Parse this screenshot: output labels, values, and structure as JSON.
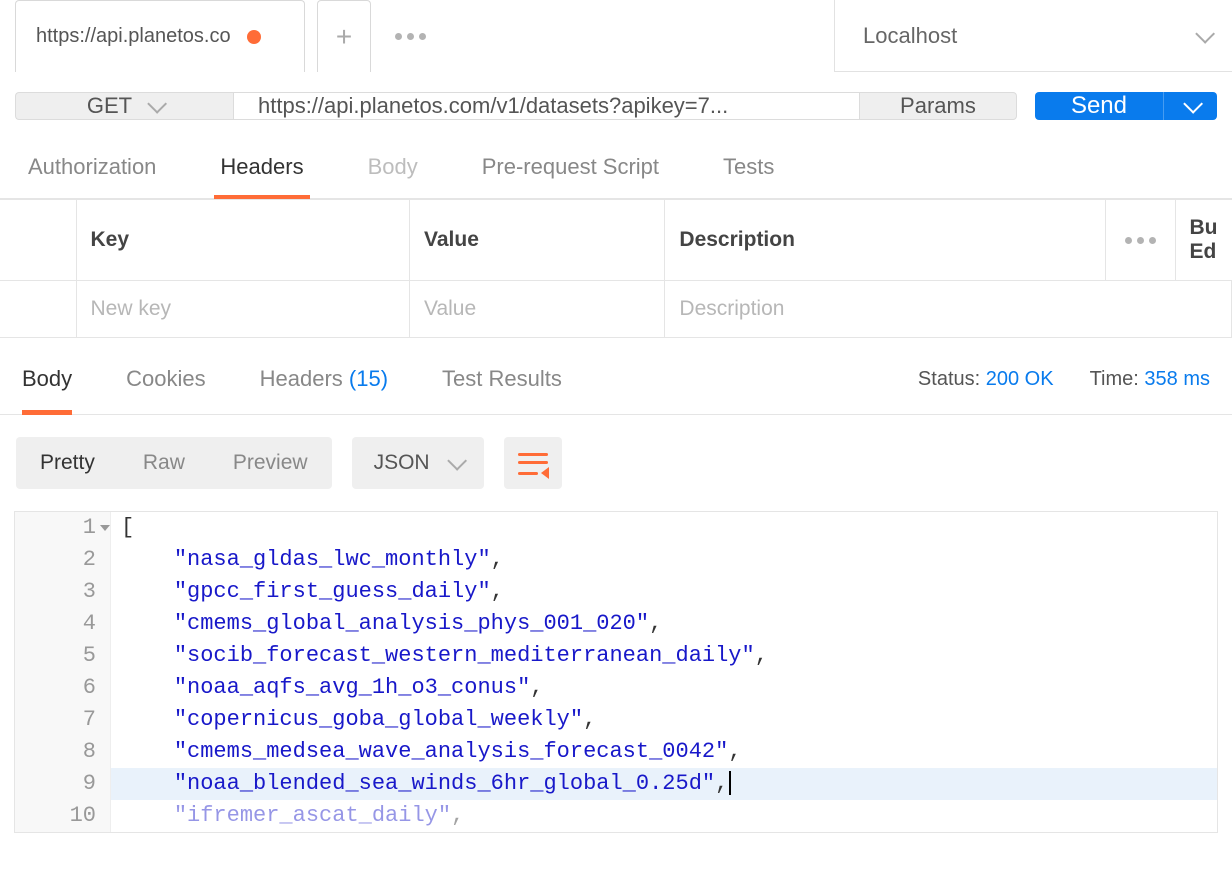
{
  "tabs": {
    "active_title": "https://api.planetos.co"
  },
  "environment": {
    "selected": "Localhost"
  },
  "request": {
    "method": "GET",
    "url_display": "https://api.planetos.com/v1/datasets?apikey=7...",
    "params_label": "Params",
    "send_label": "Send"
  },
  "request_tabs": {
    "authorization": "Authorization",
    "headers": "Headers",
    "body": "Body",
    "prerequest": "Pre-request Script",
    "tests": "Tests"
  },
  "headers_table": {
    "col_key": "Key",
    "col_value": "Value",
    "col_desc": "Description",
    "bulk_link_1": "Bu",
    "bulk_link_2": "Ed",
    "placeholder_key": "New key",
    "placeholder_value": "Value",
    "placeholder_desc": "Description"
  },
  "response_tabs": {
    "body": "Body",
    "cookies": "Cookies",
    "headers": "Headers",
    "headers_count": "(15)",
    "tests": "Test Results"
  },
  "response_meta": {
    "status_label": "Status:",
    "status_value": "200 OK",
    "time_label": "Time:",
    "time_value": "358 ms"
  },
  "body_view": {
    "pretty": "Pretty",
    "raw": "Raw",
    "preview": "Preview",
    "format": "JSON"
  },
  "response_body": {
    "lines": [
      {
        "n": "1",
        "indent": "",
        "text": "[",
        "string": false,
        "comma": false,
        "fold": true
      },
      {
        "n": "2",
        "indent": "    ",
        "text": "nasa_gldas_lwc_monthly",
        "string": true,
        "comma": true
      },
      {
        "n": "3",
        "indent": "    ",
        "text": "gpcc_first_guess_daily",
        "string": true,
        "comma": true
      },
      {
        "n": "4",
        "indent": "    ",
        "text": "cmems_global_analysis_phys_001_020",
        "string": true,
        "comma": true
      },
      {
        "n": "5",
        "indent": "    ",
        "text": "socib_forecast_western_mediterranean_daily",
        "string": true,
        "comma": true
      },
      {
        "n": "6",
        "indent": "    ",
        "text": "noaa_aqfs_avg_1h_o3_conus",
        "string": true,
        "comma": true
      },
      {
        "n": "7",
        "indent": "    ",
        "text": "copernicus_goba_global_weekly",
        "string": true,
        "comma": true
      },
      {
        "n": "8",
        "indent": "    ",
        "text": "cmems_medsea_wave_analysis_forecast_0042",
        "string": true,
        "comma": true
      },
      {
        "n": "9",
        "indent": "    ",
        "text": "noaa_blended_sea_winds_6hr_global_0.25d",
        "string": true,
        "comma": true,
        "highlight": true,
        "cursor": true
      },
      {
        "n": "10",
        "indent": "    ",
        "text": "ifremer_ascat_daily",
        "string": true,
        "comma": true,
        "faded": true
      }
    ]
  }
}
